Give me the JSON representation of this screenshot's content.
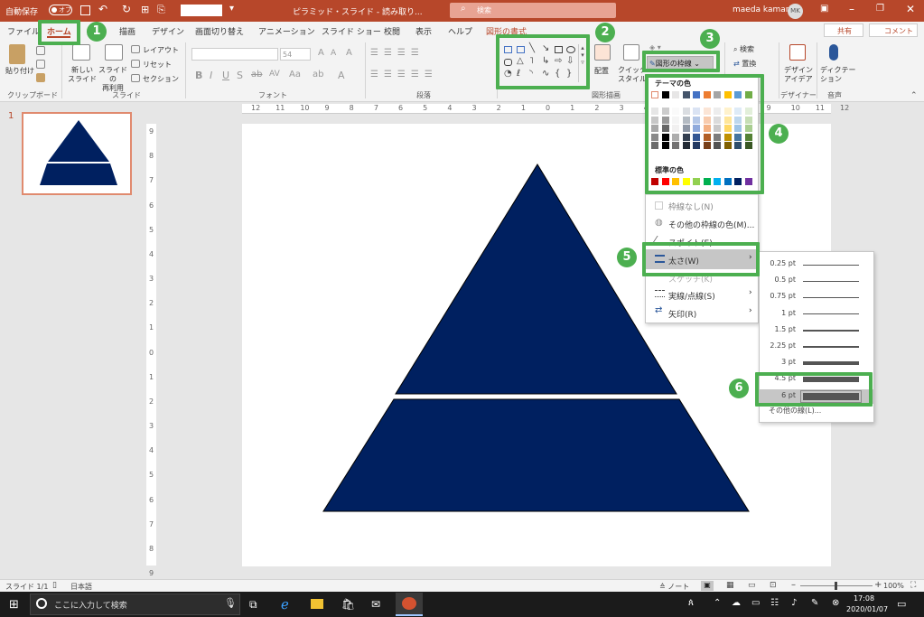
{
  "titlebar": {
    "autosave_label": "自動保存",
    "autosave_state": "オフ",
    "doc_title": "ピラミッド・スライド - 読み取り...",
    "search_placeholder": "検索",
    "user_name": "maeda kamari",
    "user_initials": "MK"
  },
  "tabs": [
    "ファイル",
    "ホーム",
    "挿入",
    "描画",
    "デザイン",
    "画面切り替え",
    "アニメーション",
    "スライド ショー",
    "校閲",
    "表示",
    "ヘルプ",
    "図形の書式"
  ],
  "share": {
    "share_label": "共有",
    "comment_label": "コメント"
  },
  "ribbon": {
    "paste_label": "貼り付け",
    "new_slide_label": "新しい\nスライド",
    "reuse_slide_label": "スライドの\n再利用",
    "layout_label": "レイアウト",
    "reset_label": "リセット",
    "section_label": "セクション",
    "font_size": "54",
    "arrange_label": "配置",
    "quick_style_label": "クイック\nスタイル",
    "outline_button_label": "図形の枠線",
    "find_label": "検索",
    "replace_label": "置換",
    "select_label": "選択",
    "designer_label": "デザイン\nアイデア",
    "dictate_label": "ディクテー\nション",
    "groups": {
      "clipboard": "クリップボード",
      "slides": "スライド",
      "font": "フォント",
      "paragraph": "段落",
      "drawing": "図形描画",
      "designer": "デザイナー",
      "voice": "音声"
    }
  },
  "callouts": [
    "1",
    "2",
    "3",
    "4",
    "5",
    "6"
  ],
  "slide_panel": {
    "slide_number": "1"
  },
  "ruler_ticks": [
    "12",
    "11",
    "10",
    "9",
    "8",
    "7",
    "6",
    "5",
    "4",
    "3",
    "2",
    "1",
    "0",
    "1",
    "2",
    "3",
    "4",
    "5",
    "6",
    "7",
    "8",
    "9",
    "10",
    "11",
    "12"
  ],
  "vruler_ticks": [
    "9",
    "8",
    "7",
    "6",
    "5",
    "4",
    "3",
    "2",
    "1",
    "0",
    "1",
    "2",
    "3",
    "4",
    "5",
    "6",
    "7",
    "8",
    "9"
  ],
  "outline_menu": {
    "theme_header": "テーマの色",
    "standard_header": "標準の色",
    "no_outline": "枠線なし(N)",
    "more_colors": "その他の枠線の色(M)...",
    "eyedropper": "スポイト(E)",
    "weight": "太さ(W)",
    "sketched": "スケッチ(K)",
    "dashes": "実線/点線(S)",
    "arrows": "矢印(R)",
    "theme_row": [
      "#ffffff",
      "#000000",
      "#e7e6e6",
      "#44546a",
      "#4472c4",
      "#ed7d31",
      "#a5a5a5",
      "#ffc000",
      "#5b9bd5",
      "#70ad47"
    ],
    "standard_row": [
      "#c00000",
      "#ff0000",
      "#ffc000",
      "#ffff00",
      "#92d050",
      "#00b050",
      "#00b0f0",
      "#0070c0",
      "#002060",
      "#7030a0"
    ]
  },
  "weight_menu": {
    "items": [
      {
        "label": "0.25 pt",
        "pt": 0.25
      },
      {
        "label": "0.5 pt",
        "pt": 0.5
      },
      {
        "label": "0.75 pt",
        "pt": 0.75
      },
      {
        "label": "1 pt",
        "pt": 1
      },
      {
        "label": "1.5 pt",
        "pt": 1.5
      },
      {
        "label": "2.25 pt",
        "pt": 2.25
      },
      {
        "label": "3 pt",
        "pt": 3
      },
      {
        "label": "4.5 pt",
        "pt": 4.5
      },
      {
        "label": "6 pt",
        "pt": 6
      }
    ],
    "selected": "6 pt",
    "more_lines": "その他の線(L)..."
  },
  "status": {
    "slide_info": "スライド 1/1",
    "language": "日本語",
    "notes_label": "ノート",
    "zoom": "100%"
  },
  "taskbar": {
    "search_placeholder": "ここに入力して検索",
    "time": "17:08",
    "date": "2020/01/07"
  },
  "colors": {
    "accent": "#b7472a",
    "pyramid": "#002060",
    "highlight": "#4caf50"
  }
}
